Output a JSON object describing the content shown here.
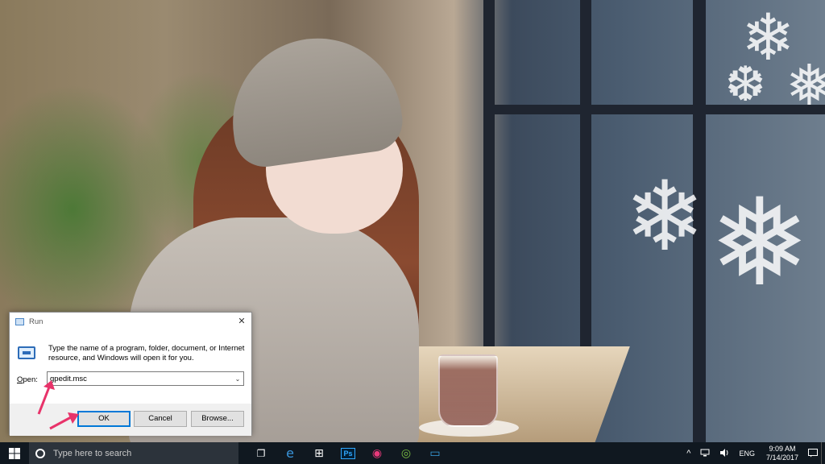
{
  "run_dialog": {
    "title": "Run",
    "description": "Type the name of a program, folder, document, or Internet resource, and Windows will open it for you.",
    "open_label_underlined": "O",
    "open_label_rest": "pen:",
    "input_value": "gpedit.msc",
    "ok_label": "OK",
    "cancel_label": "Cancel",
    "browse_label": "Browse...",
    "close_glyph": "✕",
    "dropdown_glyph": "⌄"
  },
  "taskbar": {
    "search_placeholder": "Type here to search",
    "apps": [
      {
        "icon": "task-view-icon",
        "glyph": "❐"
      },
      {
        "icon": "edge-icon",
        "glyph": "e",
        "color": "#3a96dd"
      },
      {
        "icon": "store-icon",
        "glyph": "⊞"
      },
      {
        "icon": "photoshop-icon",
        "glyph": "Ps",
        "color": "#31a8ff"
      },
      {
        "icon": "app-pink-icon",
        "glyph": "◉",
        "color": "#e83a7b"
      },
      {
        "icon": "app-green-icon",
        "glyph": "◎",
        "color": "#7bc043"
      },
      {
        "icon": "app-blue-icon",
        "glyph": "▭",
        "color": "#39a0e0"
      }
    ],
    "tray": {
      "chevron": "^",
      "language": "ENG",
      "time": "9:09 AM",
      "date": "7/14/2017"
    }
  },
  "colors": {
    "taskbar_bg": "#101820",
    "accent": "#0078d7",
    "arrow": "#e8336a"
  }
}
